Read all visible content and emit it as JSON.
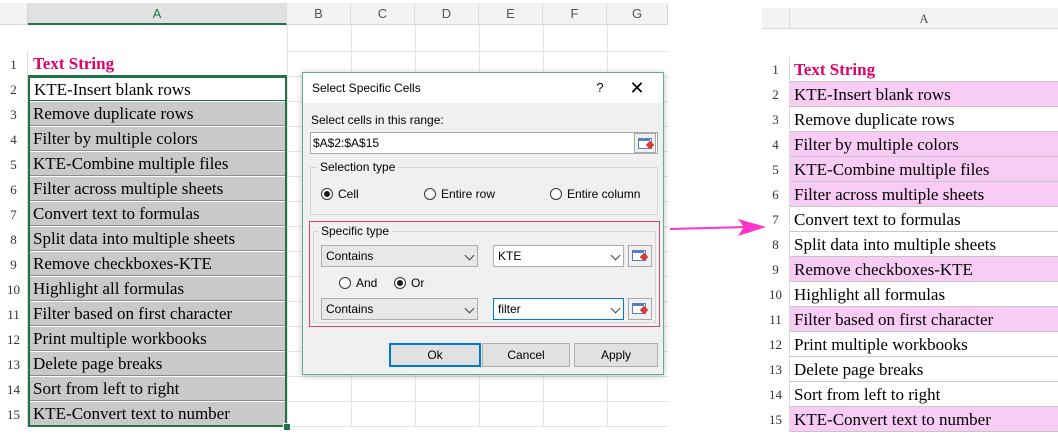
{
  "left_sheet": {
    "columns": [
      "A",
      "B",
      "C",
      "D",
      "E",
      "F",
      "G"
    ],
    "header_cell": "Text String",
    "row_numbers": [
      "1",
      "2",
      "3",
      "4",
      "5",
      "6",
      "7",
      "8",
      "9",
      "10",
      "11",
      "12",
      "13",
      "14",
      "15"
    ],
    "rows": [
      "KTE-Insert blank rows",
      "Remove duplicate rows",
      "Filter by multiple colors",
      "KTE-Combine multiple files",
      "Filter across multiple sheets",
      "Convert text to formulas",
      "Split data into multiple sheets",
      "Remove checkboxes-KTE",
      "Highlight all formulas",
      "Filter based on first character",
      "Print multiple workbooks",
      "Delete page breaks",
      "Sort from left to right",
      "KTE-Convert text to number"
    ]
  },
  "dialog": {
    "title": "Select Specific Cells",
    "help": "?",
    "close": "✕",
    "range_label": "Select cells in this range:",
    "range_value": "$A$2:$A$15",
    "selection_type_label": "Selection type",
    "selection_options": [
      "Cell",
      "Entire row",
      "Entire column"
    ],
    "selection_selected": "Cell",
    "specific_type_label": "Specific type",
    "condition1_op": "Contains",
    "condition1_value": "KTE",
    "logic_options": [
      "And",
      "Or"
    ],
    "logic_selected": "Or",
    "condition2_op": "Contains",
    "condition2_value": "filter",
    "ok_label": "Ok",
    "cancel_label": "Cancel",
    "apply_label": "Apply"
  },
  "right_sheet": {
    "column": "A",
    "header_cell": "Text String",
    "row_numbers": [
      "1",
      "2",
      "3",
      "4",
      "5",
      "6",
      "7",
      "8",
      "9",
      "10",
      "11",
      "12",
      "13",
      "14",
      "15"
    ],
    "rows": [
      {
        "text": "KTE-Insert blank rows",
        "highlighted": true
      },
      {
        "text": "Remove duplicate rows",
        "highlighted": false
      },
      {
        "text": "Filter by multiple colors",
        "highlighted": true
      },
      {
        "text": "KTE-Combine multiple files",
        "highlighted": true
      },
      {
        "text": "Filter across multiple sheets",
        "highlighted": true
      },
      {
        "text": "Convert text to formulas",
        "highlighted": false
      },
      {
        "text": "Split data into multiple sheets",
        "highlighted": false
      },
      {
        "text": "Remove checkboxes-KTE",
        "highlighted": true
      },
      {
        "text": "Highlight all formulas",
        "highlighted": false
      },
      {
        "text": "Filter based on first character",
        "highlighted": true
      },
      {
        "text": "Print multiple workbooks",
        "highlighted": false
      },
      {
        "text": "Delete page breaks",
        "highlighted": false
      },
      {
        "text": "Sort from left to right",
        "highlighted": false
      },
      {
        "text": "KTE-Convert text to number",
        "highlighted": true
      }
    ],
    "highlight_color": "#f9ccf5"
  },
  "colors": {
    "header_text": "#e0006a",
    "selection_green": "#217346",
    "arrow": "#ff33cc",
    "specific_border": "#d0457e"
  }
}
